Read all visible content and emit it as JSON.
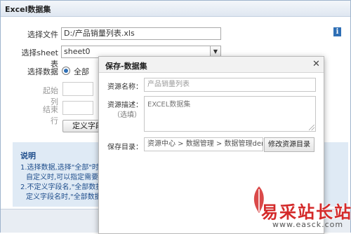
{
  "window": {
    "title": "Excel数据集"
  },
  "form": {
    "file_label": "选择文件",
    "file_value": "D:/产品销量列表.xls",
    "sheet_label": "选择sheet表",
    "sheet_value": "sheet0",
    "data_label": "选择数据",
    "radio_all_label": "全部",
    "start_col_label": "起始列",
    "end_row_label": "结束行",
    "define_field_button": "定义字段"
  },
  "notes": {
    "title": "说明",
    "lines": [
      "1.选择数据,选择\"全部\"时,对",
      "自定义时,可以指定需要使用",
      "2.不定义字段名,\"全部数据\"将",
      "定义字段名时,\"全部数据\"将"
    ]
  },
  "modal": {
    "title": "保存-数据集",
    "name_label": "资源名称：",
    "name_value": "产品销量列表",
    "desc_label": "资源描述：",
    "desc_optional": "（选填）",
    "desc_value": "EXCEL数据集",
    "dir_label": "保存目录：",
    "dir_value": "资源中心 > 数据管理 > 数据管理demo",
    "change_dir_button": "修改资源目录"
  },
  "watermark": {
    "cn": "易采站长站",
    "en": "www.easck.com"
  },
  "colors": {
    "accent": "#2f6fb5",
    "note_bg": "#dfeaf5",
    "note_text": "#1f4e8c",
    "watermark": "#d42a2a"
  },
  "icons": {
    "info": "info-icon",
    "close": "close-icon",
    "dropdown": "chevron-down-icon"
  }
}
